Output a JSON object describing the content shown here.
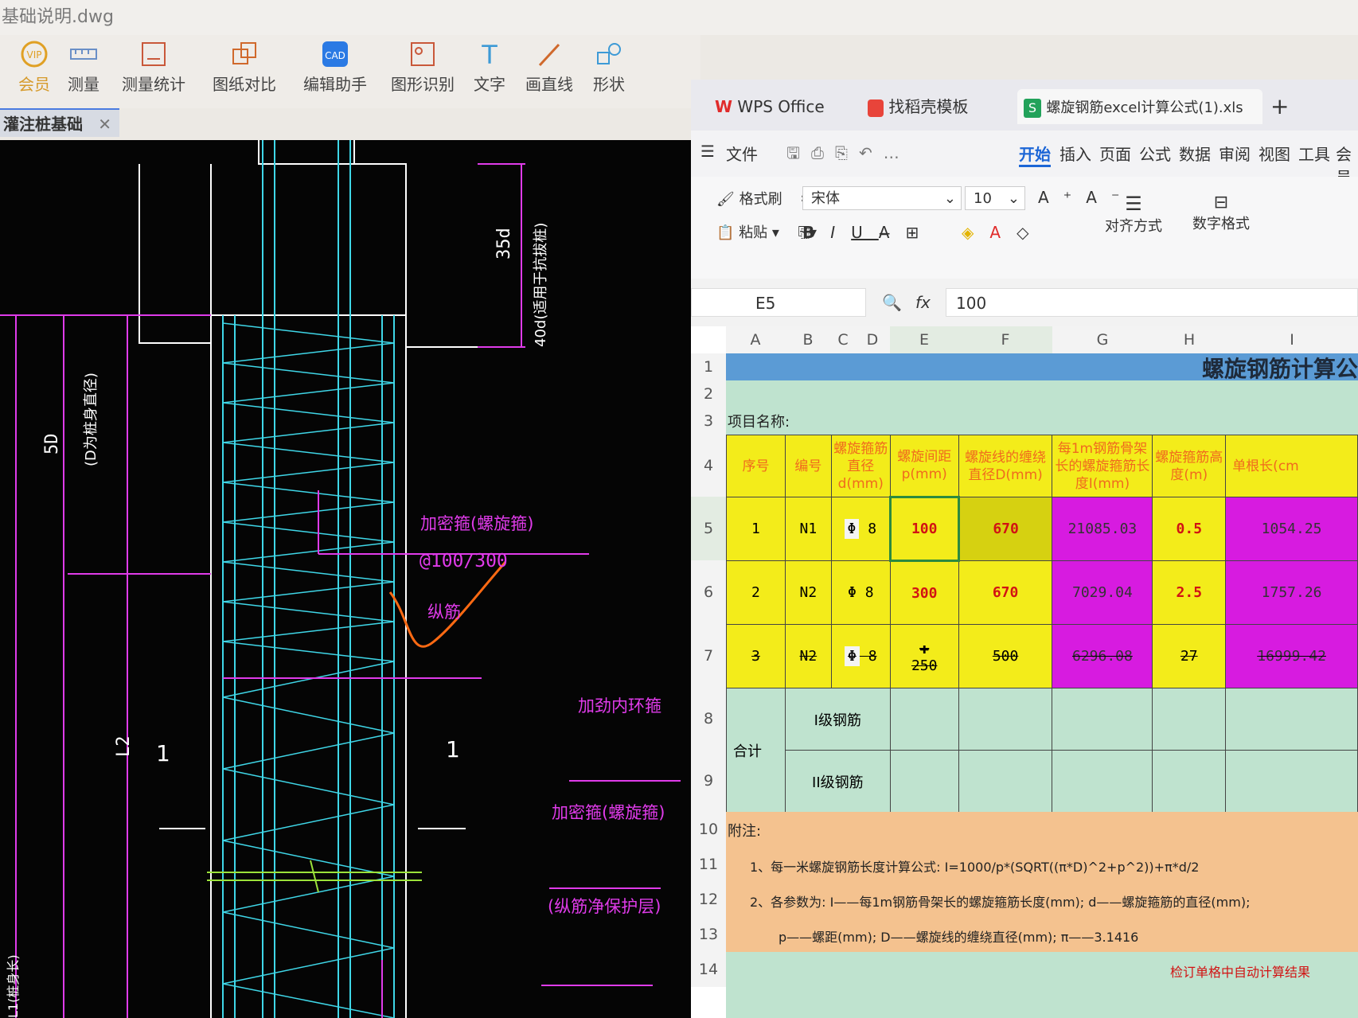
{
  "cad": {
    "title": "基础说明.dwg",
    "tools": [
      {
        "label": "会员",
        "icon": "vip-icon"
      },
      {
        "label": "测量",
        "icon": "ruler-icon"
      },
      {
        "label": "测量统计",
        "icon": "measure-stats-icon"
      },
      {
        "label": "图纸对比",
        "icon": "compare-icon"
      },
      {
        "label": "编辑助手",
        "icon": "edit-helper-icon"
      },
      {
        "label": "图形识别",
        "icon": "shape-recognition-icon"
      },
      {
        "label": "文字",
        "icon": "text-icon"
      },
      {
        "label": "画直线",
        "icon": "line-icon"
      },
      {
        "label": "形状",
        "icon": "shape-icon"
      }
    ],
    "tab": "灌注桩基础",
    "drawing": {
      "dim_35d": "35d",
      "dim_40d": "40d(适用于抗拔桩)",
      "dim_5d": "5D",
      "dim_5d_note": "(D为桩身直径)",
      "label_jiamigu": "加密箍(螺旋箍)",
      "label_spacing": "@100/300",
      "label_zongjin": "纵筋",
      "label_neihuan": "加劲内环箍",
      "label_jiamigu2": "加密箍(螺旋箍)",
      "label_baohu": "(纵筋净保护层)",
      "label_l2": "L2",
      "label_sec1": "1",
      "label_sec2": "1",
      "label_left": "L1(桩身长)"
    }
  },
  "wps": {
    "tabs": [
      {
        "label": "WPS Office",
        "icon": "wps-logo-icon"
      },
      {
        "label": "找稻壳模板",
        "icon": "docer-icon"
      },
      {
        "label": "螺旋钢筋excel计算公式(1).xls",
        "icon": "sheet-icon"
      }
    ],
    "file_menu": "文件",
    "ribbon_tabs": [
      "开始",
      "插入",
      "页面",
      "公式",
      "数据",
      "审阅",
      "视图",
      "工具",
      "会员"
    ],
    "active_tab": "开始",
    "ribbon": {
      "format_painter": "格式刷",
      "paste": "粘贴",
      "font_name": "宋体",
      "font_size": "10",
      "align": "对齐方式",
      "number_format": "数字格式"
    },
    "name_box": "E5",
    "fx": "fx",
    "formula_value": "100",
    "columns": [
      "A",
      "B",
      "C",
      "D",
      "E",
      "F",
      "G",
      "H",
      "I"
    ],
    "rows": [
      "1",
      "2",
      "3",
      "4",
      "5",
      "6",
      "7",
      "8",
      "9",
      "10",
      "11",
      "12",
      "13",
      "14"
    ],
    "sheet_title": "螺旋钢筋计算公",
    "project_label": "项目名称:",
    "headers": [
      "序号",
      "编号",
      "螺旋箍筋直径d(mm)",
      "螺旋间距p(mm)",
      "螺旋线的缠绕直径D(mm)",
      "每1m钢筋骨架长的螺旋箍筋长度I(mm)",
      "螺旋箍筋高度(m)",
      "单根长(cm"
    ],
    "data_rows": [
      {
        "seq": "1",
        "code": "N1",
        "dia_sym": "Φ",
        "dia": "8",
        "p": "100",
        "D": "670",
        "len1m": "21085.03",
        "height": "0.5",
        "single": "1054.25"
      },
      {
        "seq": "2",
        "code": "N2",
        "dia_sym": "Φ",
        "dia": "8",
        "p": "300",
        "D": "670",
        "len1m": "7029.04",
        "height": "2.5",
        "single": "1757.26"
      },
      {
        "seq": "3",
        "code": "N2",
        "dia_sym": "Φ",
        "dia": "8",
        "p": "250",
        "D": "500",
        "len1m": "6296.08",
        "height": "27",
        "single": "16999.42"
      }
    ],
    "total_label": "合计",
    "total_rows": [
      "I级钢筋",
      "II级钢筋"
    ],
    "notes_title": "附注:",
    "notes": [
      "1、每一米螺旋钢筋长度计算公式: I=1000/p*(SQRT((π*D)^2+p^2))+π*d/2",
      "2、各参数为: I——每1m钢筋骨架长的螺旋箍筋长度(mm); d——螺旋箍筋的直径(mm);",
      "p——螺距(mm); D——螺旋线的缠绕直径(mm); π——3.1416"
    ],
    "footer_note": "检订单格中自动计算结果"
  }
}
